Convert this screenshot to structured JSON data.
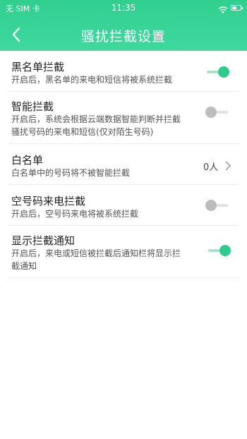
{
  "status_bar": {
    "carrier": "无 SIM 卡",
    "time": "11:35",
    "wifi_icon": "wifi-icon",
    "battery_icon": "battery-icon"
  },
  "nav": {
    "back_icon": "chevron-left-icon",
    "title": "骚扰拦截设置"
  },
  "settings": {
    "blacklist": {
      "title": "黑名单拦截",
      "subtitle": "开启后，黑名单的来电和短信将被系统拦截",
      "enabled": true
    },
    "smart": {
      "title": "智能拦截",
      "subtitle_line1": "开启后，系统会根据云端数据智能判断并拦截",
      "subtitle_line2": "骚扰号码的来电和短信(仅对陌生号码)",
      "enabled": false
    },
    "whitelist": {
      "title": "白名单",
      "subtitle": "白名单中的号码将不被智能拦截",
      "count": "0人"
    },
    "empty_number": {
      "title": "空号码来电拦截",
      "subtitle": "开启后，空号码来电将被系统拦截",
      "enabled": false
    },
    "notify": {
      "title": "显示拦截通知",
      "subtitle_line1": "开启后，来电或短信被拦截后通知栏将显示拦",
      "subtitle_line2": "截通知",
      "enabled": true
    }
  },
  "colors": {
    "accent": "#2ecb8d",
    "header": "#36d396"
  }
}
